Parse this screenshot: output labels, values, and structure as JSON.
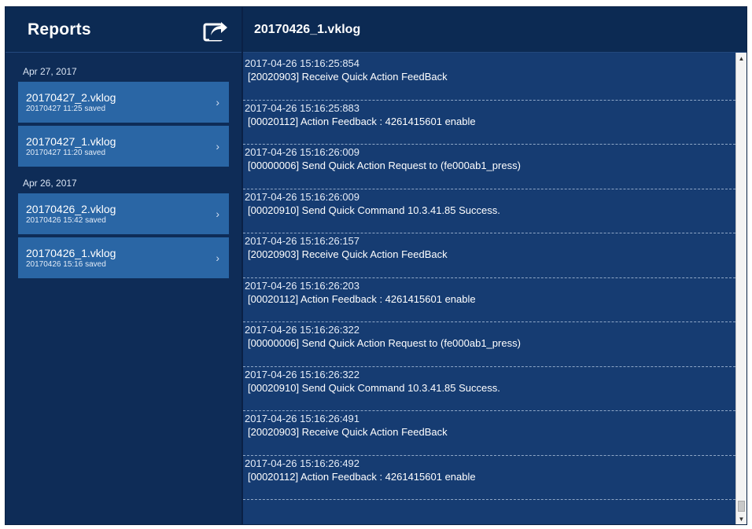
{
  "sidebar": {
    "title": "Reports",
    "export_icon": "share-export-icon",
    "groups": [
      {
        "date": "Apr 27, 2017",
        "items": [
          {
            "name": "20170427_2.vklog",
            "saved": "20170427 11:25 saved"
          },
          {
            "name": "20170427_1.vklog",
            "saved": "20170427 11:20 saved"
          }
        ]
      },
      {
        "date": "Apr 26, 2017",
        "items": [
          {
            "name": "20170426_2.vklog",
            "saved": "20170426 15:42 saved"
          },
          {
            "name": "20170426_1.vklog",
            "saved": "20170426 15:16 saved"
          }
        ]
      }
    ],
    "chevron": "›"
  },
  "main": {
    "title": "20170426_1.vklog",
    "logs": [
      {
        "time": "2017-04-26 15:16:25:854",
        "msg": "[20020903] Receive Quick Action FeedBack"
      },
      {
        "time": "2017-04-26 15:16:25:883",
        "msg": "[00020112] Action Feedback : 4261415601 enable"
      },
      {
        "time": "2017-04-26 15:16:26:009",
        "msg": "[00000006] Send Quick Action Request to (fe000ab1_press)"
      },
      {
        "time": "2017-04-26 15:16:26:009",
        "msg": "[00020910] Send Quick Command 10.3.41.85 Success."
      },
      {
        "time": "2017-04-26 15:16:26:157",
        "msg": "[20020903] Receive Quick Action FeedBack"
      },
      {
        "time": "2017-04-26 15:16:26:203",
        "msg": "[00020112] Action Feedback : 4261415601 enable"
      },
      {
        "time": "2017-04-26 15:16:26:322",
        "msg": "[00000006] Send Quick Action Request to (fe000ab1_press)"
      },
      {
        "time": "2017-04-26 15:16:26:322",
        "msg": "[00020910] Send Quick Command 10.3.41.85 Success."
      },
      {
        "time": "2017-04-26 15:16:26:491",
        "msg": "[20020903] Receive Quick Action FeedBack"
      },
      {
        "time": "2017-04-26 15:16:26:492",
        "msg": "[00020112] Action Feedback : 4261415601 enable"
      }
    ]
  },
  "colors": {
    "panel_dark": "#0c2a53",
    "sidebar_bg": "#0e2c57",
    "item_bg": "#2a66a5",
    "log_bg": "#163c72"
  }
}
